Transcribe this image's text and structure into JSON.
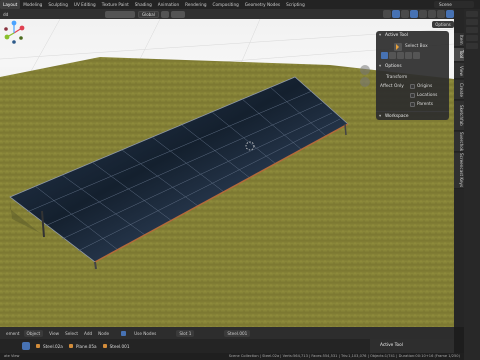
{
  "workspace_tabs": [
    "Layout",
    "Modeling",
    "Sculpting",
    "UV Editing",
    "Texture Paint",
    "Shading",
    "Animation",
    "Rendering",
    "Compositing",
    "Geometry Nodes",
    "Scripting"
  ],
  "active_tab": "Layout",
  "scene_label": "Scene",
  "header": {
    "mode_label": "dd",
    "orientation_label": "Global",
    "options_label": "Options"
  },
  "tool_panel": {
    "active_tool_title": "Active Tool",
    "select_box_label": "Select Box",
    "options_title": "Options",
    "transform_label": "Transform",
    "affect_only_label": "Affect Only",
    "origins_label": "Origins",
    "locations_label": "Locations",
    "parents_label": "Parents",
    "workspace_label": "Workspace"
  },
  "side_tabs": [
    "Item",
    "Tool",
    "View",
    "Create",
    "Sketchfab",
    "Sverchok",
    "Screencast Keys"
  ],
  "bottom_header": {
    "items": [
      "Object",
      "View",
      "Select",
      "Add",
      "Node"
    ],
    "use_nodes_label": "Use Nodes",
    "slot_label": "Slot 1",
    "material_label": "Steel.001",
    "prefix_label": "ement"
  },
  "timeline": {
    "crumbs": [
      "Steel.02a",
      "Plane.05a",
      "Steel.001"
    ],
    "active_tool_label": "Active Tool"
  },
  "status": {
    "left": "ate View",
    "right": "Scene Collection | Steel.02a | Verts:564,713 | Faces:554,531 | Tris:1,103,076 | Objects:1/741 | Duration:00:10+16 (Frame 1/250)"
  },
  "colors": {
    "accent": "#4772b3",
    "grass": "#8d8a3a",
    "panel": "#1c2736"
  }
}
